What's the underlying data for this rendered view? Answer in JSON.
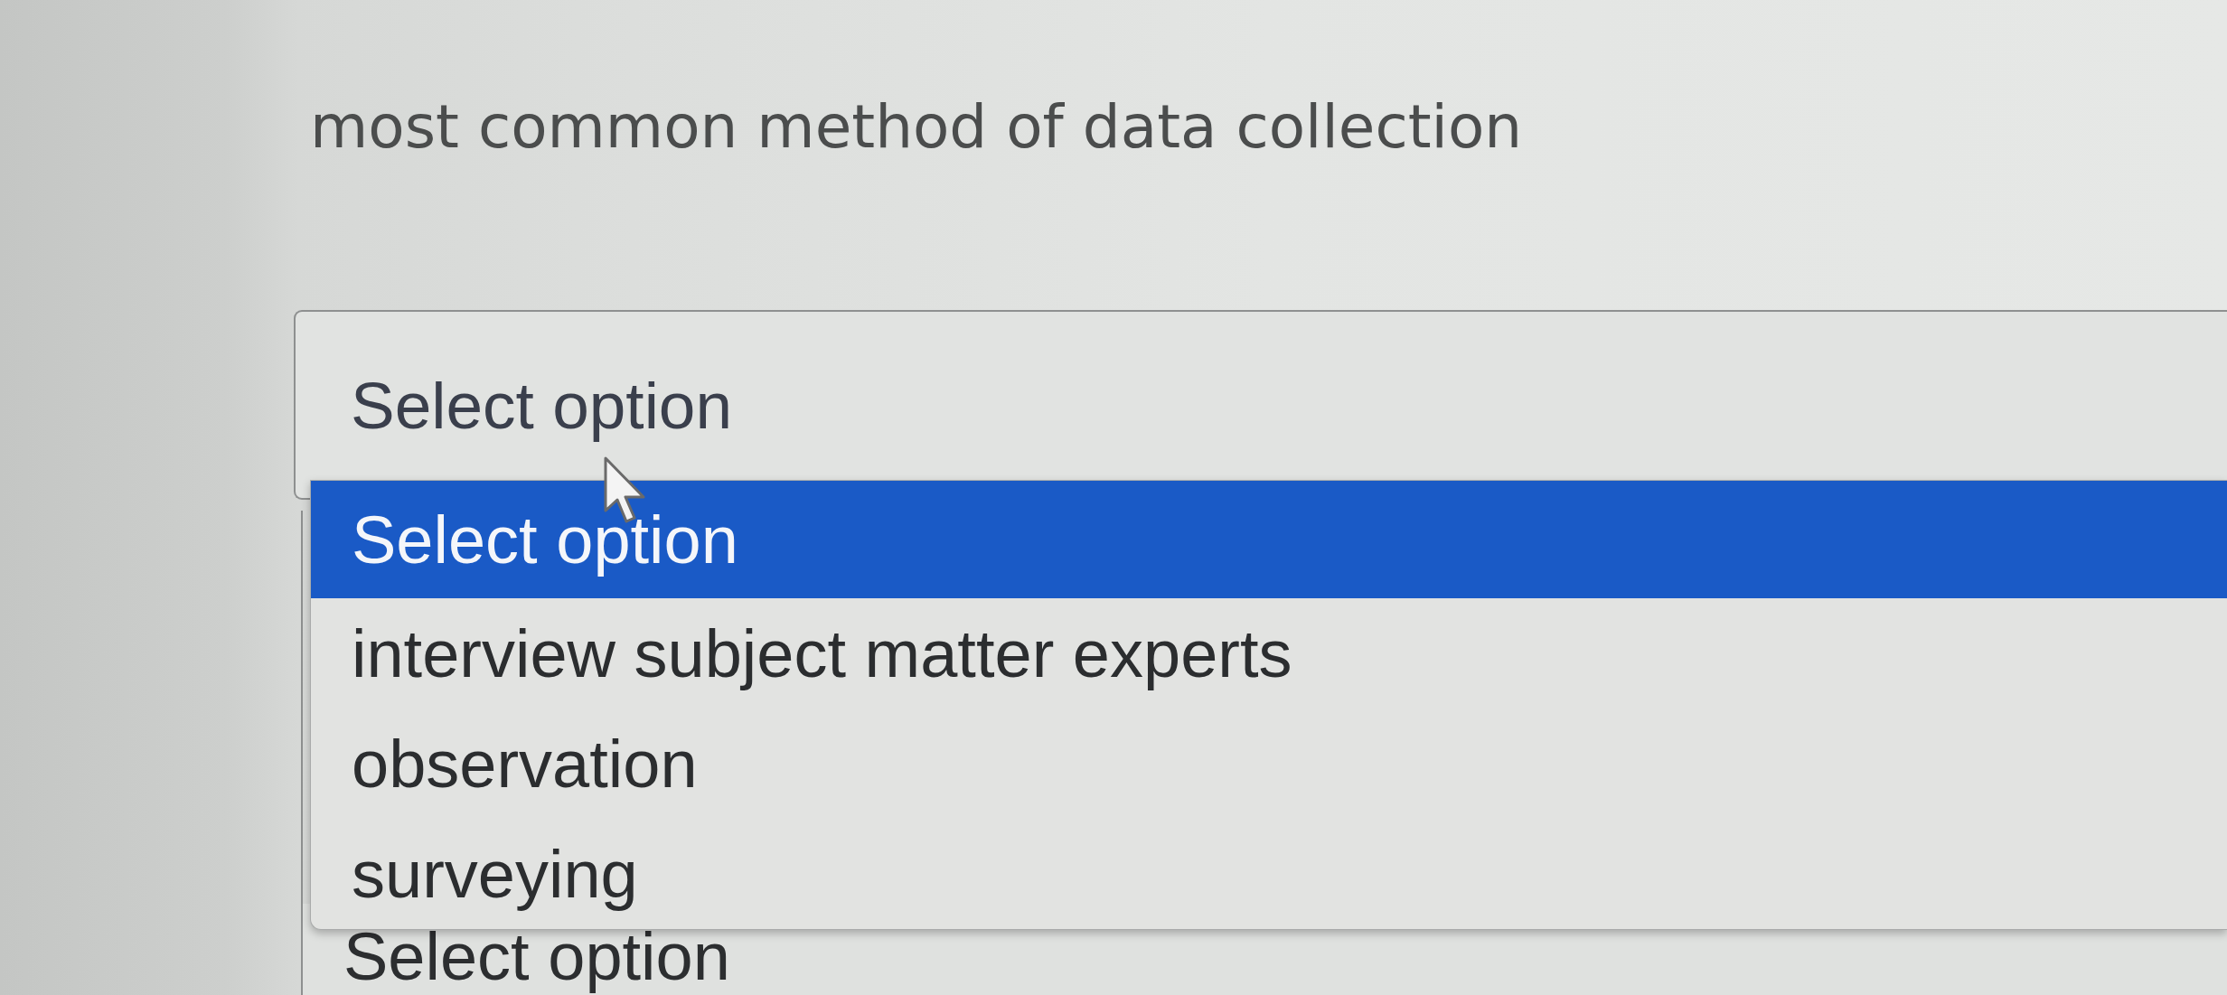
{
  "question": {
    "text": "most common method of data collection"
  },
  "select": {
    "value": "Select option",
    "expanded": true
  },
  "dropdown": {
    "options": [
      {
        "label": "Select option",
        "selected": true
      },
      {
        "label": "interview subject matter experts",
        "selected": false
      },
      {
        "label": "observation",
        "selected": false
      },
      {
        "label": "surveying",
        "selected": false
      }
    ]
  },
  "next_select": {
    "value": "Select option"
  }
}
